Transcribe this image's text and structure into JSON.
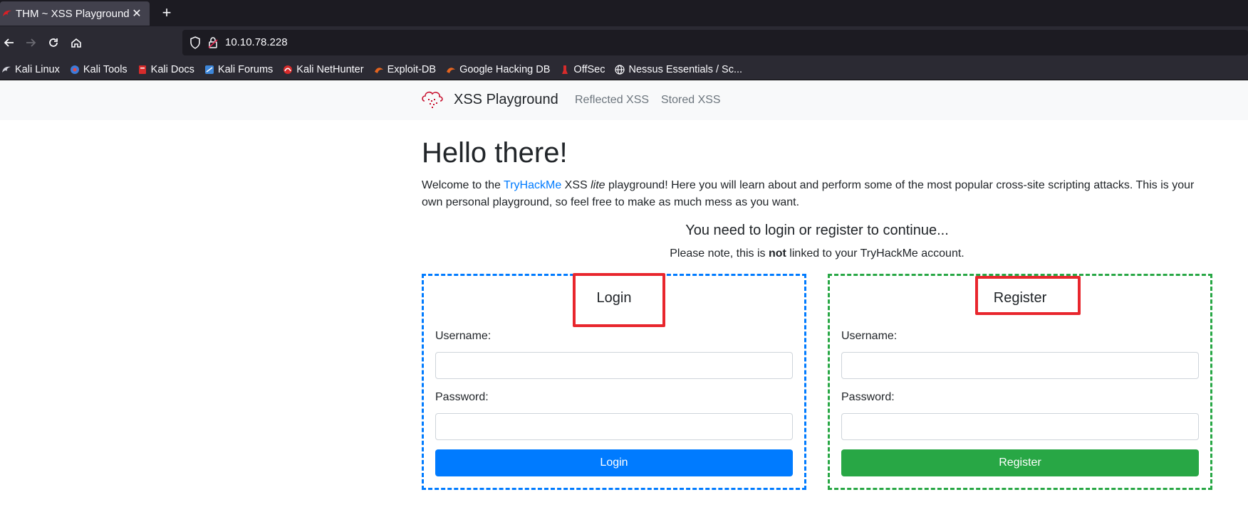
{
  "browser": {
    "tab_title": "THM ~ XSS Playground",
    "close_glyph": "✕",
    "new_tab_glyph": "+",
    "url": "10.10.78.228",
    "bookmarks": [
      {
        "label": "Kali Linux",
        "icon": "kali-dragon-icon"
      },
      {
        "label": "Kali Tools",
        "icon": "kali-tools-icon"
      },
      {
        "label": "Kali Docs",
        "icon": "kali-docs-icon"
      },
      {
        "label": "Kali Forums",
        "icon": "kali-forums-icon"
      },
      {
        "label": "Kali NetHunter",
        "icon": "nethunter-icon"
      },
      {
        "label": "Exploit-DB",
        "icon": "exploitdb-icon"
      },
      {
        "label": "Google Hacking DB",
        "icon": "ghdb-icon"
      },
      {
        "label": "OffSec",
        "icon": "offsec-icon"
      },
      {
        "label": "Nessus Essentials / Sc...",
        "icon": "globe-icon"
      }
    ]
  },
  "site": {
    "brand": "XSS Playground",
    "nav": {
      "reflected": "Reflected XSS",
      "stored": "Stored XSS"
    },
    "heading": "Hello there!",
    "intro": {
      "pre": "Welcome to the ",
      "link": "TryHackMe",
      "mid": " XSS ",
      "em": "lite",
      "post": " playground! Here you will learn about and perform some of the most popular cross-site scripting attacks. This is your own personal playground, so feel free to make as much mess as you want."
    },
    "need": "You need to login or register to continue...",
    "note": {
      "pre": "Please note, this is ",
      "strong": "not",
      "post": " linked to your TryHackMe account."
    },
    "login": {
      "title": "Login",
      "username_label": "Username:",
      "password_label": "Password:",
      "button": "Login"
    },
    "register": {
      "title": "Register",
      "username_label": "Username:",
      "password_label": "Password:",
      "button": "Register"
    }
  },
  "colors": {
    "primary": "#007bff",
    "success": "#28a745",
    "annotation": "#e8262d"
  }
}
